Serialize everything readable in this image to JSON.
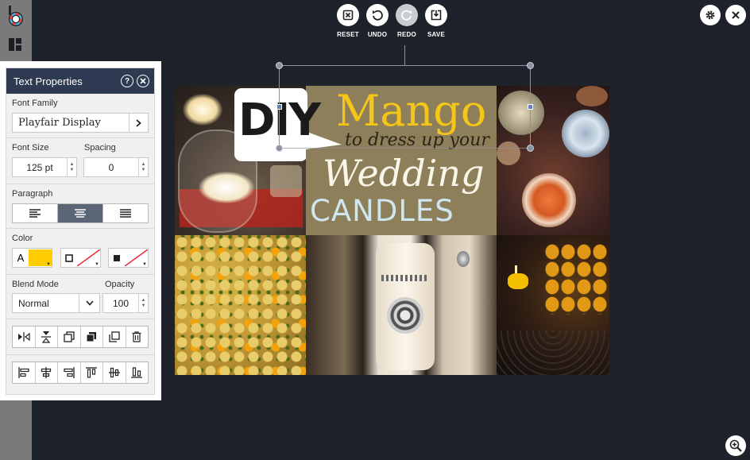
{
  "toolbar": {
    "reset": "RESET",
    "undo": "UNDO",
    "redo": "REDO",
    "save": "SAVE"
  },
  "design": {
    "diy": "DIY",
    "mango": "Mango",
    "subtitle": "to dress up your",
    "wedding": "Wedding",
    "candles": "CANDLES"
  },
  "panel": {
    "title": "Text Properties",
    "help": "?",
    "font_family_label": "Font Family",
    "font_family_value": "Playfair Display",
    "font_size_label": "Font Size",
    "font_size_value": "125 pt",
    "spacing_label": "Spacing",
    "spacing_value": "0",
    "paragraph_label": "Paragraph",
    "color_label": "Color",
    "color_letter": "A",
    "text_color": "#ffcc00",
    "blend_mode_label": "Blend Mode",
    "blend_mode_value": "Normal",
    "opacity_label": "Opacity",
    "opacity_value": "100"
  },
  "colors": {
    "panel_header": "#2d3a52",
    "canvas_bg": "#1e222b",
    "mango_yellow": "#f5c518",
    "olive_box": "#8d7f59",
    "candles_blue": "#cfe6ee"
  },
  "icons": {
    "app_logo": "logo-icon",
    "layout": "layout-icon",
    "reset": "reset-icon",
    "undo": "undo-icon",
    "redo": "redo-icon",
    "save": "save-icon",
    "settings": "gear-icon",
    "close": "close-icon",
    "zoom": "zoom-in-icon"
  }
}
